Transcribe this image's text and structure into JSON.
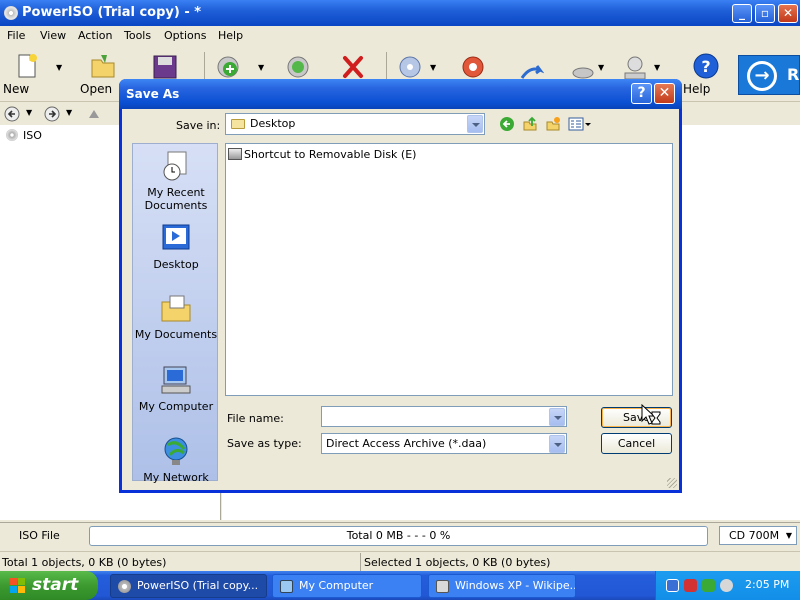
{
  "window": {
    "title": "PowerISO (Trial copy) - *"
  },
  "menu": [
    "File",
    "View",
    "Action",
    "Tools",
    "Options",
    "Help"
  ],
  "toolbar": {
    "new_label": "New",
    "open_label": "Open",
    "help_label": "Help",
    "banner_text": "R"
  },
  "tree": {
    "root_label": "ISO"
  },
  "dialog": {
    "title": "Save As",
    "save_in_label": "Save in:",
    "save_in_value": "Desktop",
    "places": [
      "My Recent Documents",
      "Desktop",
      "My Documents",
      "My Computer",
      "My Network"
    ],
    "files": [
      {
        "name": "Shortcut to Removable Disk (E)"
      }
    ],
    "file_name_label": "File name:",
    "file_name_value": "",
    "save_as_type_label": "Save as type:",
    "save_as_type_value": "Direct Access Archive (*.daa)",
    "save_button": "Save",
    "cancel_button": "Cancel"
  },
  "statusbar": {
    "type_label": "ISO File",
    "progress_text": "Total  0 MB   - - -  0 %",
    "capacity": "CD 700M",
    "left_text": "Total 1 objects, 0 KB (0 bytes)",
    "right_text": "Selected 1 objects, 0 KB (0 bytes)"
  },
  "taskbar": {
    "start_label": "start",
    "tasks": [
      "PowerISO (Trial copy...",
      "My Computer",
      "Windows XP - Wikipe..."
    ],
    "clock": "2:05 PM"
  },
  "colors": {
    "xp_blue": "#0a46c4",
    "start_green": "#3c9a30",
    "banner_blue": "#1a78d8"
  }
}
